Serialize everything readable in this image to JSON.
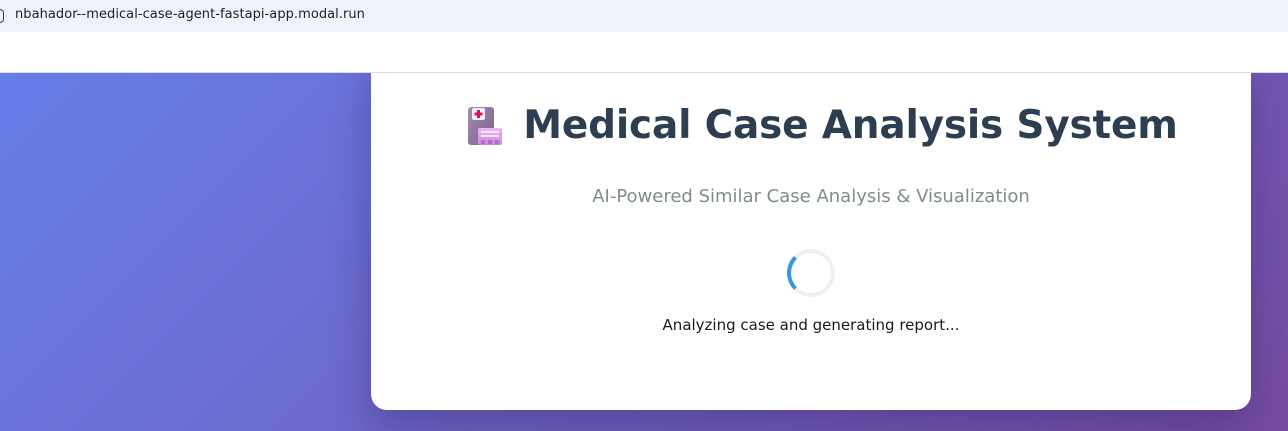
{
  "browser": {
    "url": "nbahador--medical-case-agent-fastapi-app.modal.run",
    "site_info_icon": "tune-icon"
  },
  "page": {
    "title": "Medical Case Analysis System",
    "title_icon": "hospital-icon",
    "subtitle": "AI-Powered Similar Case Analysis & Visualization",
    "loading_text": "Analyzing case and generating report...",
    "spinner_icon": "loading-spinner"
  },
  "colors": {
    "background_gradient_start": "#667eea",
    "background_gradient_end": "#764ba2",
    "title": "#2c3e50",
    "subtitle": "#7f8c8d",
    "spinner_accent": "#3498db",
    "card": "#ffffff"
  }
}
